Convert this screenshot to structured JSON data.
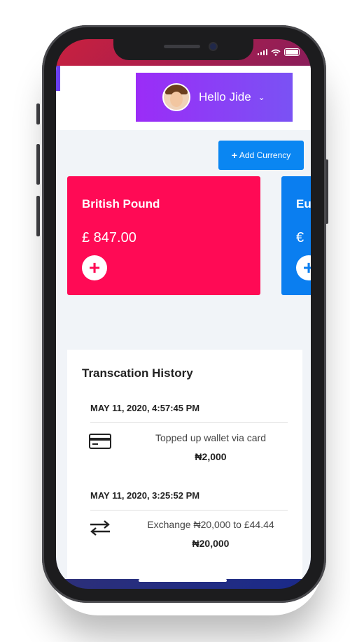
{
  "header": {
    "greeting": "Hello Jide",
    "dropdown_icon": "chevron-down-icon"
  },
  "actions": {
    "add_currency_label": "Add Currency",
    "add_currency_icon": "plus-icon"
  },
  "wallets": [
    {
      "name": "British Pound",
      "balance": "£ 847.00",
      "color": "#ff0a55"
    },
    {
      "name": "Eu",
      "balance": "€",
      "color": "#0a7ef0"
    }
  ],
  "history": {
    "title": "Transcation History",
    "transactions": [
      {
        "date": "MAY 11, 2020, 4:57:45 PM",
        "icon": "credit-card-icon",
        "description": "Topped up wallet via card",
        "amount": "₦2,000"
      },
      {
        "date": "MAY 11, 2020, 3:25:52 PM",
        "icon": "exchange-arrows-icon",
        "description": "Exchange ₦20,000 to £44.44",
        "amount": "₦20,000"
      }
    ]
  },
  "colors": {
    "accent_purple": "#7a52f4",
    "button_blue": "#0a86f2",
    "background": "#f1f4f8"
  }
}
